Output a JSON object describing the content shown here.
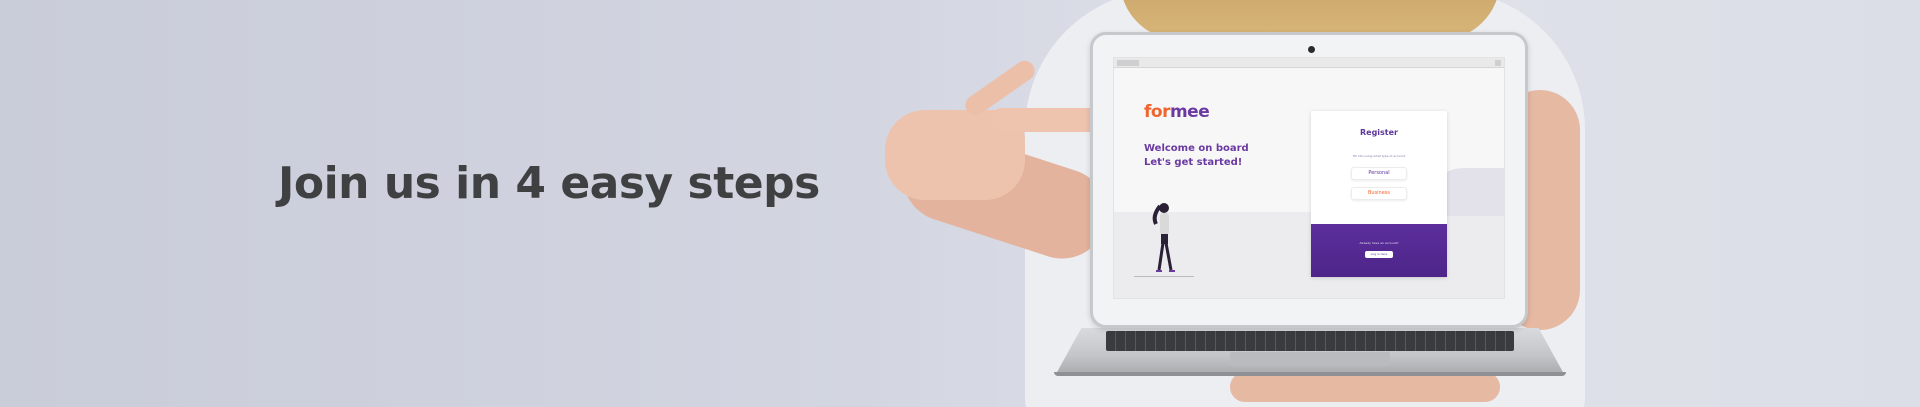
{
  "headline": "Join us in 4 easy steps",
  "app": {
    "logo_part1": "for",
    "logo_part2": "mee",
    "welcome_line1": "Welcome on board",
    "welcome_line2": "Let's get started!"
  },
  "register_card": {
    "title": "Register",
    "subtitle": "Fill info using what type of account",
    "personal_label": "Personal",
    "business_label": "Business",
    "footer_text": "Already have an account?",
    "login_label": "Log in here"
  },
  "colors": {
    "brand_purple": "#5b3799",
    "brand_orange": "#f0642d",
    "headline": "#3f4042"
  }
}
